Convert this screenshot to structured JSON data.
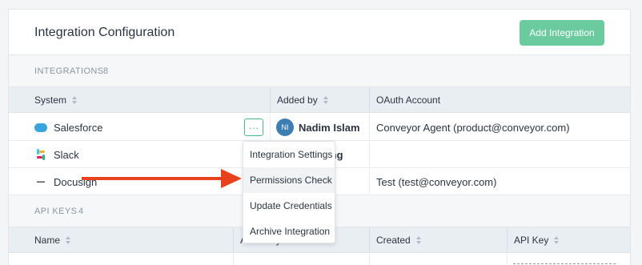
{
  "header": {
    "title": "Integration Configuration",
    "add_button": "Add Integration"
  },
  "integrations": {
    "label": "INTEGRATIONS",
    "count": "8",
    "columns": [
      "System",
      "Added by",
      "OAuth Account"
    ],
    "rows": [
      {
        "system": "Salesforce",
        "icon": "salesforce-icon",
        "avatar": "NI",
        "added_by": "Nadim Islam",
        "oauth": "Conveyor Agent (product@conveyor.com)"
      },
      {
        "system": "Slack",
        "icon": "slack-icon",
        "avatar": "",
        "added_by": "Vong",
        "oauth": ""
      },
      {
        "system": "Docusign",
        "icon": "docusign-icon",
        "avatar": "",
        "added_by": "",
        "oauth": "Test (test@conveyor.com)"
      }
    ],
    "more_label": "···"
  },
  "menu": {
    "items": [
      "Integration Settings",
      "Permissions Check",
      "Update Credentials",
      "Archive Integration"
    ],
    "hovered_index": 1
  },
  "api_keys": {
    "label": "API KEYS",
    "count": "4",
    "columns": [
      "Name",
      "Added by",
      "Created",
      "API Key"
    ]
  },
  "colors": {
    "accent": "#6ccb9e",
    "arrow": "#e8421c",
    "avatar": "#3e7fb3"
  }
}
